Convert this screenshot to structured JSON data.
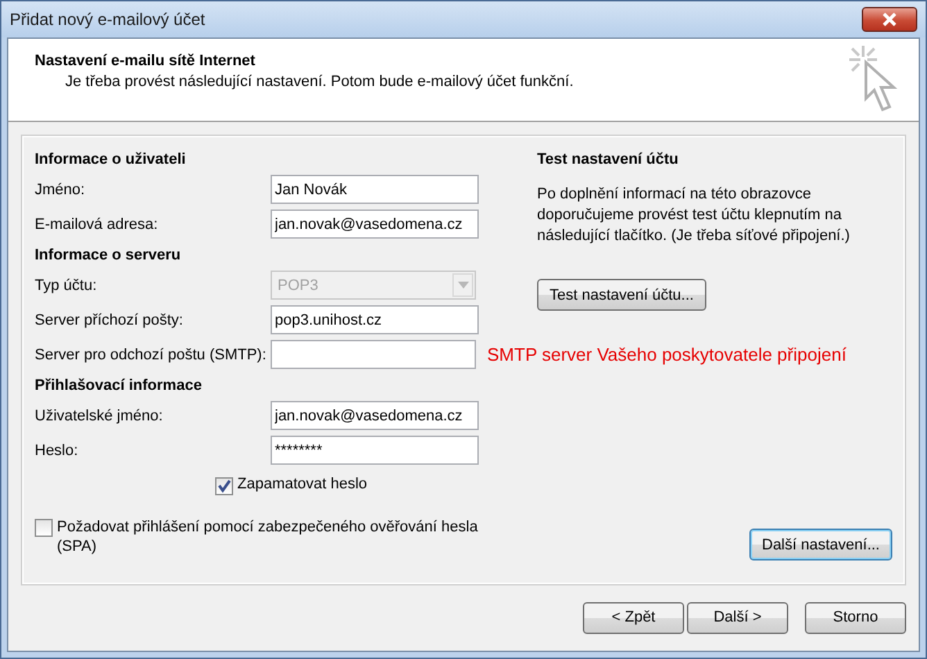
{
  "window": {
    "title": "Přidat nový e-mailový účet"
  },
  "header": {
    "title": "Nastavení e-mailu sítě Internet",
    "subtitle": "Je třeba provést následující nastavení. Potom bude e-mailový účet funkční."
  },
  "sections": [
    {
      "heading": "Informace o uživateli",
      "fields": [
        {
          "label": "Jméno:",
          "kind": "text",
          "value": "Jan Novák"
        },
        {
          "label": "E-mailová adresa:",
          "kind": "text",
          "value": "jan.novak@vasedomena.cz"
        }
      ]
    },
    {
      "heading": "Informace o serveru",
      "fields": [
        {
          "label": "Typ účtu:",
          "kind": "combo",
          "value": "POP3",
          "disabled": true
        },
        {
          "label": "Server příchozí pošty:",
          "kind": "text",
          "value": "pop3.unihost.cz"
        },
        {
          "label": "Server pro odchozí poštu (SMTP):",
          "kind": "text",
          "note": "SMTP server Vašeho poskytovatele připojení"
        }
      ]
    },
    {
      "heading": "Přihlašovací informace",
      "fields": [
        {
          "label": "Uživatelské jméno:",
          "kind": "text",
          "value": "jan.novak@vasedomena.cz"
        },
        {
          "label": "Heslo:",
          "kind": "text",
          "value": "********"
        }
      ]
    }
  ],
  "remember_password": {
    "label": "Zapamatovat heslo",
    "checked": true
  },
  "spa": {
    "label": "Požadovat přihlášení pomocí zabezpečeného ověřování hesla (SPA)",
    "checked": false
  },
  "test_panel": {
    "heading": "Test nastavení účtu",
    "text": "Po doplnění informací na této obrazovce doporučujeme provést test účtu klepnutím na následující tlačítko. (Je třeba síťové připojení.)",
    "button": "Test nastavení účtu..."
  },
  "more_settings": "Další nastavení...",
  "buttons": [
    "< Zpět",
    "Další >",
    "Storno"
  ]
}
